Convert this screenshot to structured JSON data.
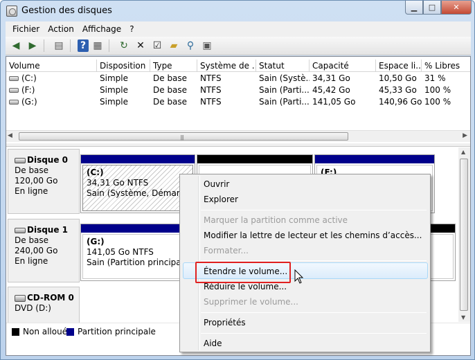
{
  "window": {
    "title": "Gestion des disques"
  },
  "menubar": {
    "items": [
      "Fichier",
      "Action",
      "Affichage",
      "?"
    ]
  },
  "toolbar": {
    "buttons": [
      "back-arrow-icon",
      "forward-arrow-icon",
      "panel-icon",
      "help-icon",
      "properties-icon",
      "refresh-icon",
      "delete-icon",
      "checklist-icon",
      "open-folder-icon",
      "search-icon",
      "console-icon"
    ]
  },
  "volumes": {
    "columns": [
      "Volume",
      "Disposition",
      "Type",
      "Système de ...",
      "Statut",
      "Capacité",
      "Espace li...",
      "% Libres"
    ],
    "rows": [
      [
        "(C:)",
        "Simple",
        "De base",
        "NTFS",
        "Sain (Systè...",
        "34,31 Go",
        "10,50 Go",
        "31 %"
      ],
      [
        "(F:)",
        "Simple",
        "De base",
        "NTFS",
        "Sain (Parti...",
        "45,42 Go",
        "45,33 Go",
        "100 %"
      ],
      [
        "(G:)",
        "Simple",
        "De base",
        "NTFS",
        "Sain (Parti...",
        "141,05 Go",
        "140,96 Go",
        "100 %"
      ]
    ]
  },
  "disks": [
    {
      "name": "Disque 0",
      "type": "De base",
      "size": "120,00 Go",
      "status": "En ligne"
    },
    {
      "name": "Disque 1",
      "type": "De base",
      "size": "240,00 Go",
      "status": "En ligne"
    },
    {
      "name": "CD-ROM 0",
      "type": "DVD (D:)",
      "size": "",
      "status": ""
    }
  ],
  "partitions": {
    "c": {
      "name": "(C:)",
      "size": "34,31 Go NTFS",
      "status": "Sain (Système, Démarrer, F"
    },
    "f": {
      "name": "(F:)"
    },
    "g": {
      "name": "(G:)",
      "size": "141,05 Go NTFS",
      "status": "Sain (Partition principale)"
    }
  },
  "legend": {
    "unallocated": "Non alloué",
    "primary": "Partition principale"
  },
  "context_menu": {
    "items": [
      {
        "label": "Ouvrir",
        "enabled": true
      },
      {
        "label": "Explorer",
        "enabled": true
      },
      {
        "label": "Marquer la partition comme active",
        "enabled": false
      },
      {
        "label": "Modifier la lettre de lecteur et les chemins d’accès...",
        "enabled": true
      },
      {
        "label": "Formater...",
        "enabled": false
      },
      {
        "label": "Étendre le volume...",
        "enabled": true,
        "highlighted": true
      },
      {
        "label": "Réduire le volume...",
        "enabled": true
      },
      {
        "label": "Supprimer le volume...",
        "enabled": false
      },
      {
        "label": "Propriétés",
        "enabled": true
      },
      {
        "label": "Aide",
        "enabled": true
      }
    ]
  },
  "colors": {
    "primary_partition": "#00008b",
    "unallocated": "#000000",
    "highlight_box": "#e02020"
  }
}
